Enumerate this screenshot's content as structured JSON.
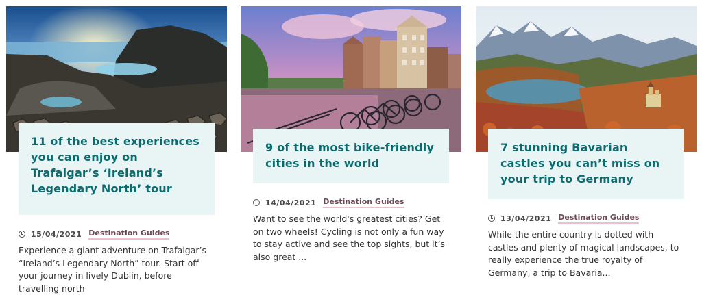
{
  "cards": [
    {
      "title": "11 of the best experiences you can enjoy on Trafalgar’s ‘Ireland’s Legendary North’ tour",
      "date": "15/04/2021",
      "category": "Destination Guides",
      "excerpt": "Experience a giant adventure on Trafalgar’s “Ireland’s Legendary North” tour. Start off your journey in lively Dublin, before travelling north"
    },
    {
      "title": "9 of the most bike-friendly cities in the world",
      "date": "14/04/2021",
      "category": "Destination Guides",
      "excerpt": "Want to see the world's greatest cities? Get on two wheels! Cycling is not only a fun way to stay active and see the top sights, but it’s also great ..."
    },
    {
      "title": "7 stunning Bavarian castles you can’t miss on your trip to Germany",
      "date": "13/04/2021",
      "category": "Destination Guides",
      "excerpt": "While the entire country is dotted with castles and plenty of magical landscapes, to really experience the true royalty of Germany, a trip to Bavaria..."
    }
  ],
  "icons": {
    "clock": "clock-icon"
  },
  "colors": {
    "title": "#0c6b6f",
    "title_bg": "#e8f5f4",
    "category_underline": "#e8c2c8"
  }
}
